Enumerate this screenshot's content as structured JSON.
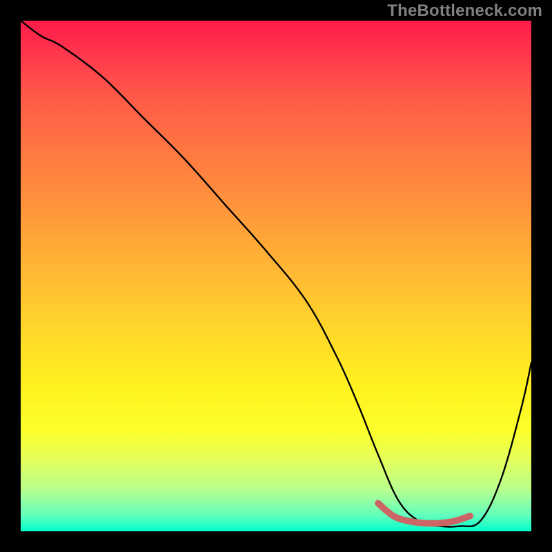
{
  "watermark": "TheBottleneck.com",
  "chart_data": {
    "type": "line",
    "title": "",
    "xlabel": "",
    "ylabel": "",
    "xlim": [
      0,
      100
    ],
    "ylim": [
      0,
      100
    ],
    "series": [
      {
        "name": "bottleneck-curve",
        "x": [
          0,
          4,
          8,
          16,
          24,
          32,
          40,
          48,
          56,
          62,
          66,
          70,
          74,
          78,
          82,
          86,
          90,
          94,
          98,
          100
        ],
        "values": [
          100,
          97,
          95,
          89,
          81,
          73,
          64,
          55,
          45,
          34,
          25,
          15,
          6,
          2,
          1,
          1,
          2,
          10,
          24,
          33
        ],
        "color": "#000000"
      },
      {
        "name": "highlight-segment",
        "x": [
          70,
          73,
          76,
          79,
          82,
          85,
          88
        ],
        "values": [
          5.5,
          3.0,
          2.0,
          1.6,
          1.6,
          2.0,
          3.0
        ],
        "color": "#cc6666",
        "stroke_width": 6
      }
    ],
    "gradient_stops": [
      {
        "pos": 0,
        "color": "#ff1a4a"
      },
      {
        "pos": 8,
        "color": "#ff3e4d"
      },
      {
        "pos": 16,
        "color": "#ff5d47"
      },
      {
        "pos": 26,
        "color": "#ff7941"
      },
      {
        "pos": 36,
        "color": "#ff933c"
      },
      {
        "pos": 48,
        "color": "#ffb534"
      },
      {
        "pos": 60,
        "color": "#ffd62a"
      },
      {
        "pos": 72,
        "color": "#fff21e"
      },
      {
        "pos": 80,
        "color": "#fdff2a"
      },
      {
        "pos": 86,
        "color": "#e4ff5a"
      },
      {
        "pos": 92,
        "color": "#b5ff90"
      },
      {
        "pos": 97,
        "color": "#5fffbe"
      },
      {
        "pos": 100,
        "color": "#00ffcc"
      }
    ]
  }
}
